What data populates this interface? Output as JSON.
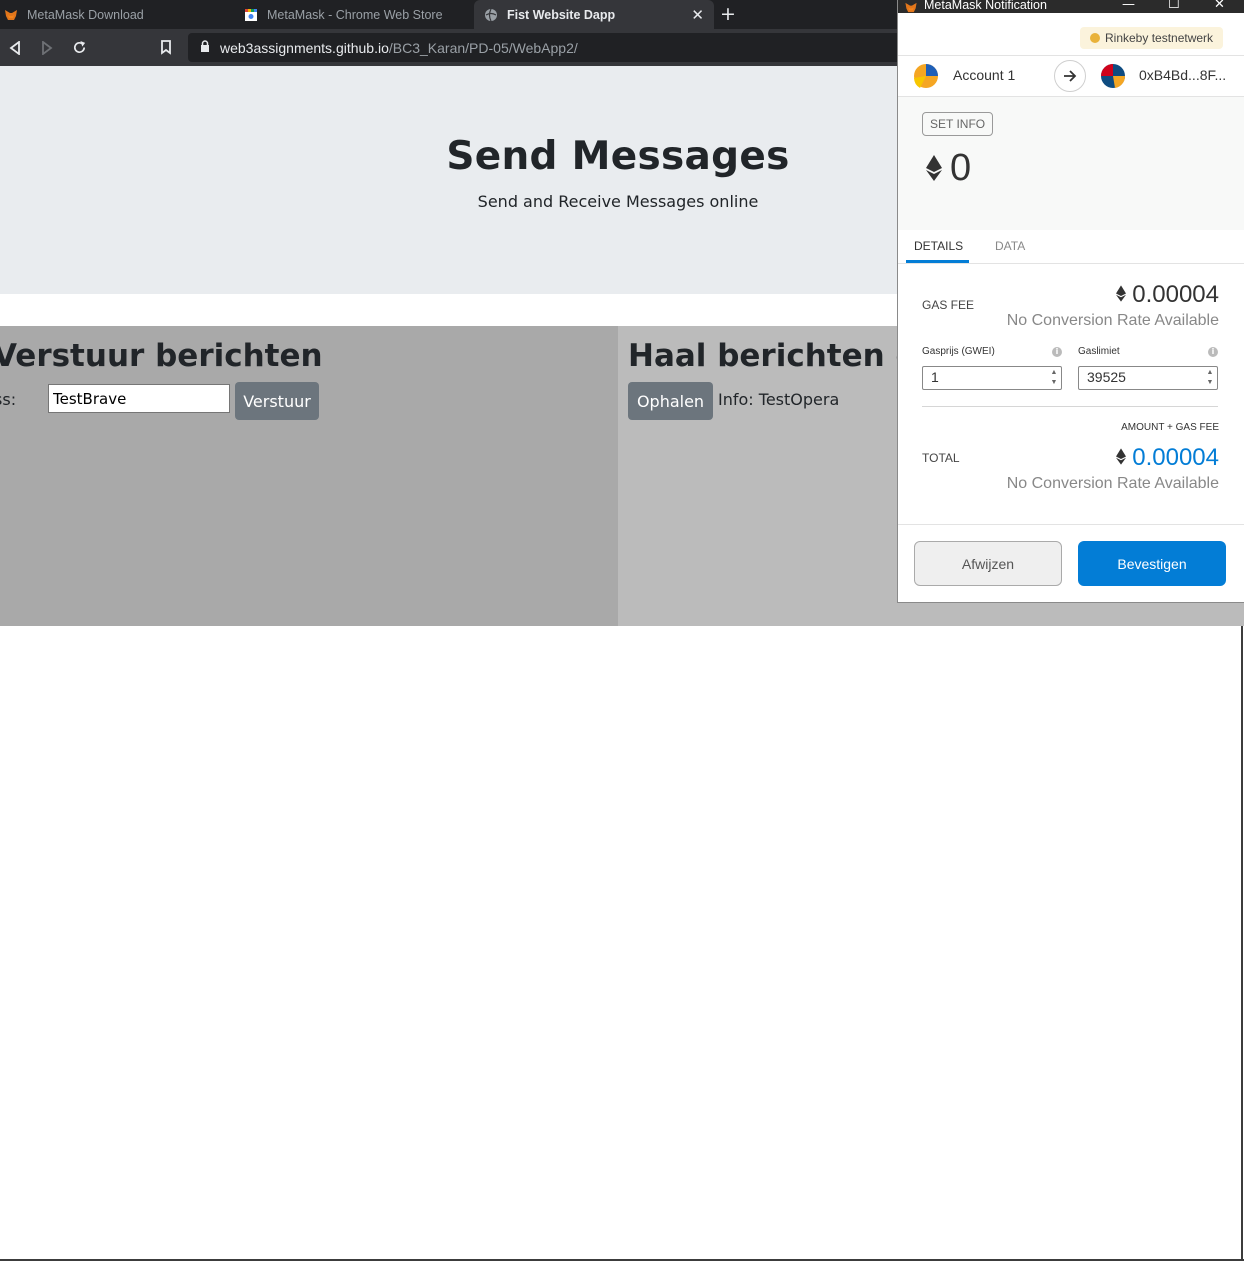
{
  "browser": {
    "tabs": [
      {
        "label": "MetaMask Download",
        "active": false
      },
      {
        "label": "MetaMask - Chrome Web Store",
        "active": false
      },
      {
        "label": "Fist Website Dapp",
        "active": true
      }
    ],
    "url_host": "web3assignments.github.io",
    "url_path": "/BC3_Karan/PD-05/WebApp2/"
  },
  "page": {
    "title": "Send Messages",
    "subtitle": "Send and Receive Messages online",
    "send": {
      "heading": "Verstuur berichten",
      "address_label": "Address:",
      "address_value": "TestBrave",
      "button": "Verstuur"
    },
    "receive": {
      "heading": "Haal berichten op",
      "button": "Ophalen",
      "info": "Info: TestOpera"
    }
  },
  "metamask": {
    "window_title": "MetaMask Notification",
    "network": "Rinkeby testnetwerk",
    "account_name": "Account 1",
    "to_address": "0xB4Bd...8F...",
    "set_info": "SET INFO",
    "amount": "0",
    "tabs": {
      "details": "DETAILS",
      "data": "DATA"
    },
    "gas_fee_label": "GAS FEE",
    "gas_fee_value": "0.00004",
    "no_conversion": "No Conversion Rate Available",
    "gas_price_label": "Gasprijs (GWEI)",
    "gas_price_value": "1",
    "gas_limit_label": "Gaslimiet",
    "gas_limit_value": "39525",
    "amount_gas_fee_label": "AMOUNT + GAS FEE",
    "total_label": "TOTAL",
    "total_value": "0.00004",
    "reject_button": "Afwijzen",
    "confirm_button": "Bevestigen"
  },
  "colors": {
    "accent": "#037dd6",
    "jumbotron": "#e9ecef",
    "left_column": "#a9a9a9",
    "right_column": "#bbbbbb",
    "button_gray": "#6c757d"
  }
}
